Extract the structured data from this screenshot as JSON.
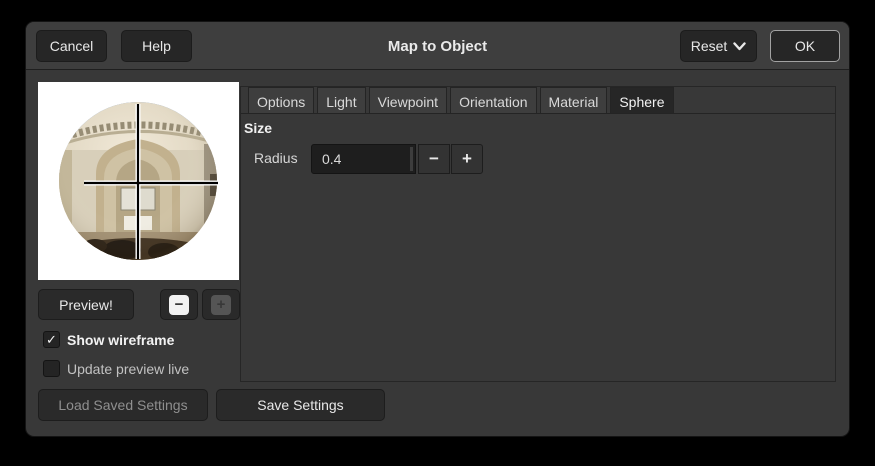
{
  "window": {
    "title": "Map to Object"
  },
  "titlebar": {
    "cancel_label": "Cancel",
    "help_label": "Help",
    "reset_label": "Reset",
    "ok_label": "OK"
  },
  "preview": {
    "button_label": "Preview!",
    "zoom_out_glyph": "−",
    "zoom_in_glyph": "+",
    "show_wireframe_label": "Show wireframe",
    "show_wireframe_checked": true,
    "check_glyph": "✓",
    "update_live_label": "Update preview live",
    "update_live_checked": false
  },
  "notebook": {
    "tabs": [
      {
        "label": "Options"
      },
      {
        "label": "Light"
      },
      {
        "label": "Viewpoint"
      },
      {
        "label": "Orientation"
      },
      {
        "label": "Material"
      },
      {
        "label": "Sphere"
      }
    ],
    "active_tab": "Sphere",
    "section_title": "Size",
    "radius_label": "Radius",
    "radius_value": "0.4",
    "minus_glyph": "−",
    "plus_glyph": "+"
  },
  "footer": {
    "load_label": "Load Saved Settings",
    "load_enabled": false,
    "save_label": "Save Settings"
  },
  "colors": {
    "dialog_bg": "#383838",
    "titlebar_bg": "#3e3e3e",
    "button_bg": "#2a2a2a",
    "active_tab_bg": "#262626",
    "entry_bg": "#1e1e1e",
    "sky": "#6b94cb",
    "stone": "#d6ccb6"
  }
}
